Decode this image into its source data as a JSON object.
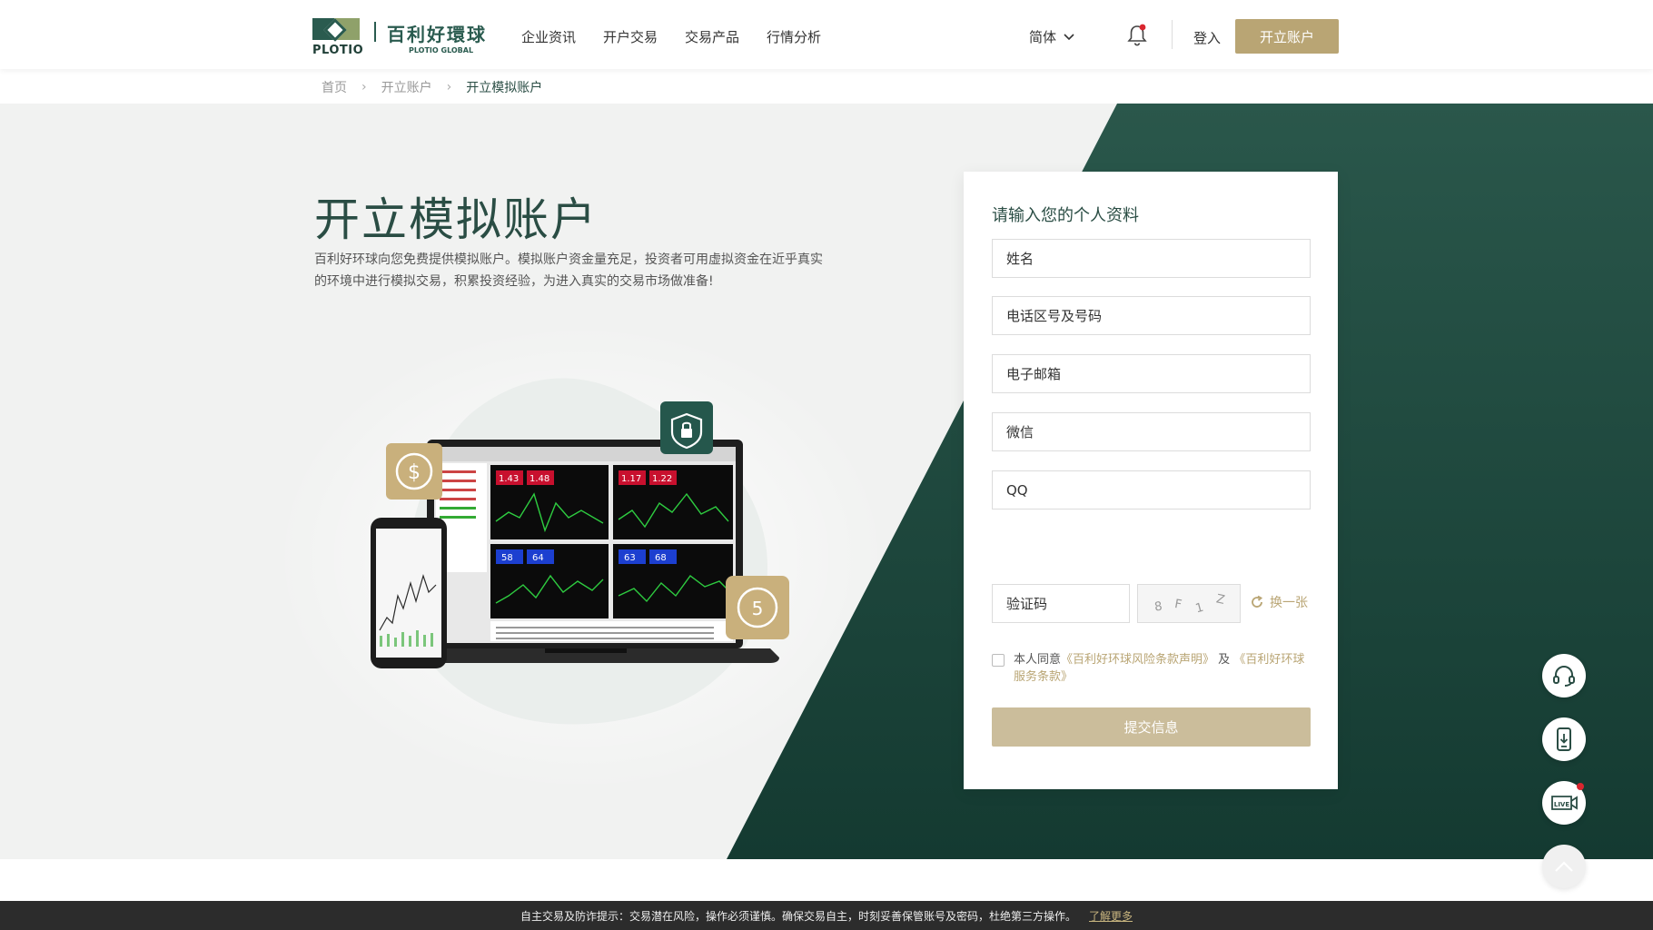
{
  "header": {
    "logo": {
      "brand_cn": "百利好環球",
      "brand_en": "PLOTIO GLOBAL",
      "mark_text": "PLOTIO"
    },
    "nav": [
      "企业资讯",
      "开户交易",
      "交易产品",
      "行情分析"
    ],
    "language": "简体",
    "login": "登入",
    "open_account": "开立账户"
  },
  "breadcrumb": {
    "home": "首页",
    "parent": "开立账户",
    "current": "开立模拟账户"
  },
  "hero": {
    "title": "开立模拟账户",
    "description": "百利好环球向您免费提供模拟账户。模拟账户资金量充足，投资者可用虚拟资金在近乎真实的环境中进行模拟交易，积累投资经验，为进入真实的交易市场做准备!"
  },
  "illustration": {
    "quotes": [
      "1.43",
      "1.48",
      "1.17",
      "1.22",
      "58",
      "64",
      "63",
      "68"
    ]
  },
  "form": {
    "title": "请输入您的个人资料",
    "name_placeholder": "姓名",
    "phone_placeholder": "电话区号及号码",
    "email_placeholder": "电子邮箱",
    "wechat_placeholder": "微信",
    "qq_placeholder": "QQ",
    "captcha_placeholder": "验证码",
    "captcha_chars": [
      "8",
      "F",
      "1",
      "Z"
    ],
    "refresh_label": "换一张",
    "agree_prefix": "本人同意",
    "agree_link1": "《百利好环球风险条款声明》",
    "agree_and": "及",
    "agree_link2": "《百利好环球服务条款》",
    "submit_label": "提交信息"
  },
  "floating": {
    "live_label": "LIVE"
  },
  "notice": {
    "text": "自主交易及防诈提示：交易潜在风险，操作必须谨慎。确保交易自主，时刻妥善保管账号及密码，杜绝第三方操作。",
    "more": "了解更多"
  },
  "colors": {
    "brand_green": "#2a4d44",
    "gold": "#b9a574",
    "dark_green_bg": "#1f4a40"
  }
}
